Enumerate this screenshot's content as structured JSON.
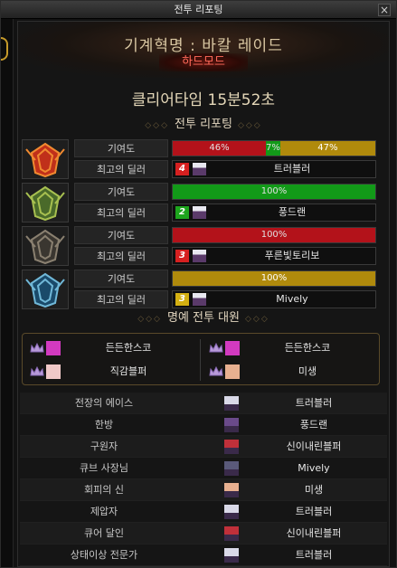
{
  "window": {
    "title": "전투 리포팅"
  },
  "header": {
    "raid_name": "기계혁명 : 바칼 레이드",
    "mode": "하드모드"
  },
  "clear_time": "클리어타임  15분52초",
  "report_section_title": "전투 리포팅",
  "honor_section_title": "명예 전투 대원",
  "labels": {
    "contribution": "기여도",
    "best_dealer": "최고의 딜러"
  },
  "parties": [
    {
      "icon": "red-crest-icon",
      "segments": [
        {
          "label": "46%",
          "value": 46,
          "color": "#b3121a"
        },
        {
          "label": "7%",
          "value": 7,
          "color": "#129a18"
        },
        {
          "label": "47%",
          "value": 47,
          "color": "#b08a0c"
        }
      ],
      "rank": "4",
      "rank_color": "#d62020",
      "dealer": "트러블러"
    },
    {
      "icon": "green-crest-icon",
      "segments": [
        {
          "label": "100%",
          "value": 100,
          "color": "#129a18"
        }
      ],
      "rank": "2",
      "rank_color": "#1da51d",
      "dealer": "풍드랜"
    },
    {
      "icon": "dark-crest-icon",
      "segments": [
        {
          "label": "100%",
          "value": 100,
          "color": "#b3121a"
        }
      ],
      "rank": "3",
      "rank_color": "#d62020",
      "dealer": "푸른빛토리보"
    },
    {
      "icon": "blue-crest-icon",
      "segments": [
        {
          "label": "100%",
          "value": 100,
          "color": "#b08a0c"
        }
      ],
      "rank": "3",
      "rank_color": "#d4b012",
      "dealer": "Mively"
    }
  ],
  "honor_members": [
    {
      "name": "든든한스코",
      "avatar_color": "#d23ac0"
    },
    {
      "name": "든든한스코",
      "avatar_color": "#d23ac0"
    },
    {
      "name": "직감블퍼",
      "avatar_color": "#f0c8c8"
    },
    {
      "name": "미생",
      "avatar_color": "#e8b090"
    }
  ],
  "awards": [
    {
      "title": "전장의 에이스",
      "player": "트러블러",
      "avatar_color": "#d9d9e8"
    },
    {
      "title": "한방",
      "player": "풍드랜",
      "avatar_color": "#6a4a8a"
    },
    {
      "title": "구원자",
      "player": "신이내린블퍼",
      "avatar_color": "#c0303a"
    },
    {
      "title": "큐브 사장님",
      "player": "Mively",
      "avatar_color": "#5a5a7a"
    },
    {
      "title": "회피의 신",
      "player": "미생",
      "avatar_color": "#e8b090"
    },
    {
      "title": "제압자",
      "player": "트러블러",
      "avatar_color": "#d9d9e8"
    },
    {
      "title": "큐어 달인",
      "player": "신이내린블퍼",
      "avatar_color": "#c0303a"
    },
    {
      "title": "상태이상 전문가",
      "player": "트러블러",
      "avatar_color": "#d9d9e8"
    }
  ],
  "colors": {
    "accent_gold": "#c69a2a",
    "hard_mode_red": "#ff6a5a"
  }
}
